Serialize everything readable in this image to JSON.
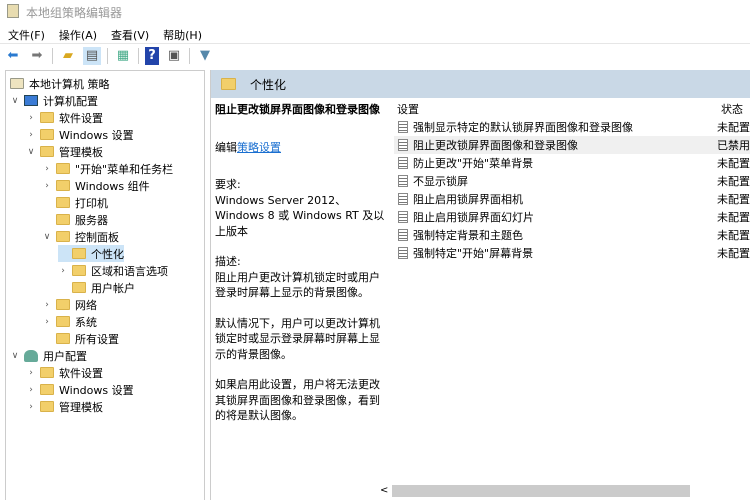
{
  "window": {
    "title": "本地组策略编辑器"
  },
  "menu": [
    "文件(F)",
    "操作(A)",
    "查看(V)",
    "帮助(H)"
  ],
  "tree": [
    {
      "label": "本地计算机 策略",
      "level": 0,
      "icon": "policy",
      "tw": ""
    },
    {
      "label": "计算机配置",
      "level": 0,
      "icon": "computer",
      "tw": "∨"
    },
    {
      "label": "软件设置",
      "level": 1,
      "icon": "folder",
      "tw": "›"
    },
    {
      "label": "Windows 设置",
      "level": 1,
      "icon": "folder",
      "tw": "›"
    },
    {
      "label": "管理模板",
      "level": 1,
      "icon": "folder",
      "tw": "∨"
    },
    {
      "label": "\"开始\"菜单和任务栏",
      "level": 2,
      "icon": "folder",
      "tw": "›"
    },
    {
      "label": "Windows 组件",
      "level": 2,
      "icon": "folder",
      "tw": "›"
    },
    {
      "label": "打印机",
      "level": 2,
      "icon": "folder",
      "tw": ""
    },
    {
      "label": "服务器",
      "level": 2,
      "icon": "folder",
      "tw": ""
    },
    {
      "label": "控制面板",
      "level": 2,
      "icon": "folder",
      "tw": "∨"
    },
    {
      "label": "个性化",
      "level": 3,
      "icon": "folder",
      "tw": "",
      "selected": true
    },
    {
      "label": "区域和语言选项",
      "level": 3,
      "icon": "folder",
      "tw": "›"
    },
    {
      "label": "用户帐户",
      "level": 3,
      "icon": "folder",
      "tw": ""
    },
    {
      "label": "网络",
      "level": 2,
      "icon": "folder",
      "tw": "›"
    },
    {
      "label": "系统",
      "level": 2,
      "icon": "folder",
      "tw": "›"
    },
    {
      "label": "所有设置",
      "level": 2,
      "icon": "folder",
      "tw": ""
    },
    {
      "label": "用户配置",
      "level": 0,
      "icon": "user",
      "tw": "∨"
    },
    {
      "label": "软件设置",
      "level": 1,
      "icon": "folder",
      "tw": "›"
    },
    {
      "label": "Windows 设置",
      "level": 1,
      "icon": "folder",
      "tw": "›"
    },
    {
      "label": "管理模板",
      "level": 1,
      "icon": "folder",
      "tw": "›"
    }
  ],
  "right": {
    "header": "个性化",
    "desc": {
      "title": "阻止更改锁屏界面图像和登录图像",
      "edit_prefix": "编辑",
      "edit_link": "策略设置",
      "req_label": "要求:",
      "req_text": "Windows Server 2012、Windows 8 或 Windows RT 及以上版本",
      "desc_label": "描述:",
      "desc_text": "阻止用户更改计算机锁定时或用户登录时屏幕上显示的背景图像。",
      "p2": "默认情况下，用户可以更改计算机锁定时或显示登录屏幕时屏幕上显示的背景图像。",
      "p3": "如果启用此设置，用户将无法更改其锁屏界面图像和登录图像，看到的将是默认图像。"
    },
    "col_setting": "设置",
    "col_state": "状态",
    "rows": [
      {
        "name": "强制显示特定的默认锁屏界面图像和登录图像",
        "state": "未配置"
      },
      {
        "name": "阻止更改锁屏界面图像和登录图像",
        "state": "已禁用",
        "highlight": true
      },
      {
        "name": "防止更改\"开始\"菜单背景",
        "state": "未配置"
      },
      {
        "name": "不显示锁屏",
        "state": "未配置"
      },
      {
        "name": "阻止启用锁屏界面相机",
        "state": "未配置"
      },
      {
        "name": "阻止启用锁屏界面幻灯片",
        "state": "未配置"
      },
      {
        "name": "强制特定背景和主题色",
        "state": "未配置"
      },
      {
        "name": "强制特定\"开始\"屏幕背景",
        "state": "未配置"
      }
    ]
  }
}
